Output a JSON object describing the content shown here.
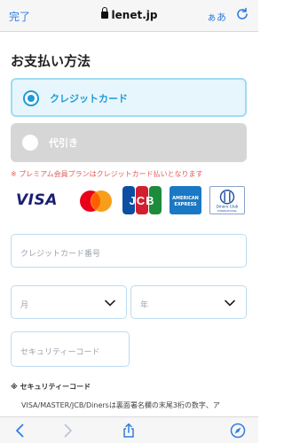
{
  "browser": {
    "done_label": "完了",
    "url": "lenet.jp",
    "text_size_label": "ぁあ",
    "accent": "#2f7de1"
  },
  "page": {
    "title": "お支払い方法"
  },
  "payment_options": [
    {
      "label": "クレジットカード",
      "selected": true
    },
    {
      "label": "代引き",
      "selected": false
    }
  ],
  "notice": "※ プレミアム会員プランはクレジットカード払いとなります",
  "card_brands": {
    "visa": "VISA",
    "mastercard": "mastercard-logo",
    "jcb": "JCB",
    "amex_top": "AMERICAN",
    "amex_bottom": "EXPRESS",
    "diners_top": "Diners Club",
    "diners_bottom": "INTERNATIONAL"
  },
  "form": {
    "card_number_placeholder": "クレジットカード番号",
    "month_placeholder": "月",
    "year_placeholder": "年",
    "cvc_placeholder": "セキュリティーコード"
  },
  "security_section": {
    "heading": "※ セキュリティーコード",
    "text": "VISA/MASTER/JCB/Dinersは裏面署名欄の末尾3桁の数字、ア"
  },
  "colors": {
    "selected_border": "#9fdcf3",
    "selected_bg": "#e7f6fc",
    "selected_text": "#1e9ad6",
    "notice": "#e25b5b",
    "disabled_bg": "#d6d6d6"
  }
}
